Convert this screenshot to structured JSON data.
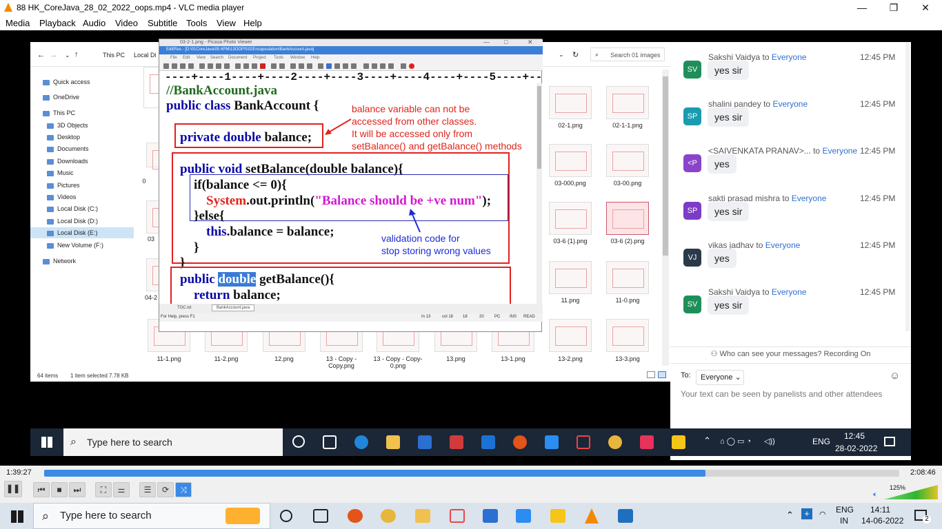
{
  "app": {
    "title": "88 HK_CoreJava_28_02_2022_oops.mp4 - VLC media player",
    "menu": [
      "Media",
      "Playback",
      "Audio",
      "Video",
      "Subtitle",
      "Tools",
      "View",
      "Help"
    ],
    "window_buttons": [
      "—",
      "❐",
      "✕"
    ]
  },
  "explorer": {
    "breadcrumb": [
      "This PC",
      "Local Di"
    ],
    "search_placeholder": "Search 01 images",
    "sidebar": [
      "Quick access",
      "OneDrive",
      "This PC",
      "3D Objects",
      "Desktop",
      "Documents",
      "Downloads",
      "Music",
      "Pictures",
      "Videos",
      "Local Disk (C:)",
      "Local Disk (D:)",
      "Local Disk (E:)",
      "New Volume (F:)",
      "Network"
    ],
    "thumbnails_right": [
      "02-1.png",
      "02-1-1.png",
      "03-000.png",
      "03-00.png",
      "03-6 (1).png",
      "03-6 (2).png",
      "11.png",
      "11-0.png"
    ],
    "thumbnails_bottom": [
      "11-1.png",
      "11-2.png",
      "12.png",
      "13 - Copy - Copy.png",
      "13 - Copy - Copy-0.png",
      "13.png",
      "13-1.png",
      "13-2.png",
      "13-3.png"
    ],
    "left_partial": [
      "0",
      "03",
      "04-2"
    ],
    "status": {
      "count": "64 items",
      "selected": "1 item selected  7.78 KB"
    }
  },
  "editplus": {
    "picasa_title": "03-2-1.png - Picasa Photo Viewer",
    "title": "EditPlus - [D:\\01CoreJava\\05 6PM\\13OOPS\\02Encapsulation\\BankAccount.java]",
    "menu": [
      "File",
      "Edit",
      "View",
      "Search",
      "Document",
      "Project",
      "Tools",
      "Window",
      "Help"
    ],
    "ruler": "----+----1----+----2----+----3----+----4----+----5----+----6---",
    "code": {
      "comment": "//BankAccount.java",
      "line_class_kw": "public class ",
      "line_class_name": "BankAccount {",
      "line_field_kw": "private double ",
      "line_field_name": "balance;",
      "line_set_kw": "public void ",
      "line_set_rest": "setBalance(double balance){",
      "line_if": "if(balance <= 0){",
      "line_print_a": "System",
      "line_print_b": ".out.println(",
      "line_print_str": "\"Balance should be +ve num\"",
      "line_print_c": ");",
      "line_else": "}else{",
      "line_this_kw": "this",
      "line_this_rest": ".balance = balance;",
      "line_close1": "}",
      "line_close2": "}",
      "line_get_kw": "public ",
      "line_get_sel": "double",
      "line_get_rest": " getBalance(){",
      "line_return_kw": "return ",
      "line_return_rest": "balance;"
    },
    "annotation1": [
      "balance variable can not be",
      "accessed from other classes.",
      "It will be accessed only from",
      "setBalance() and getBalance() methods"
    ],
    "annotation2": [
      "validation code for",
      "stop storing wrong values"
    ],
    "tabs": [
      "TOC.txt",
      "BankAccount.java"
    ],
    "status": {
      "help": "For Help, press F1",
      "ln": "In 13",
      "col": "col 18",
      "a": "18",
      "b": "20",
      "pc": "PC",
      "ins": "INS",
      "read": "READ"
    }
  },
  "chat": {
    "to_word": "to",
    "messages": [
      {
        "sender": "Sakshi Vaidya",
        "to": "Everyone",
        "time": "12:45 PM",
        "text": "yes sir",
        "initials": "SV",
        "color": "#1f8f5a"
      },
      {
        "sender": "shalini pandey",
        "to": "Everyone",
        "time": "12:45 PM",
        "text": "yes sir",
        "initials": "SP",
        "color": "#1a9bb0"
      },
      {
        "sender": "<SAIVENKATA PRANAV>...",
        "to": "Everyone",
        "time": "12:45 PM",
        "text": "yes",
        "initials": "<P",
        "color": "#8b44c9"
      },
      {
        "sender": "sakti prasad mishra",
        "to": "Everyone",
        "time": "12:45 PM",
        "text": "yes sir",
        "initials": "SP",
        "color": "#7c3cc6"
      },
      {
        "sender": "vikas jadhav",
        "to": "Everyone",
        "time": "12:45 PM",
        "text": "yes",
        "initials": "VJ",
        "color": "#2b3a4a"
      },
      {
        "sender": "Sakshi Vaidya",
        "to": "Everyone",
        "time": "12:45 PM",
        "text": "yes sir",
        "initials": "SV",
        "color": "#1f8f5a"
      }
    ],
    "who_can_see": "Who can see your messages? Recording On",
    "to_label": "To:",
    "to_value": "Everyone",
    "input_placeholder": "Your text can be seen by panelists and other attendees"
  },
  "inner_taskbar": {
    "search": "Type here to search",
    "time": "12:45",
    "date": "28-02-2022",
    "lang": "ENG"
  },
  "player": {
    "elapsed": "1:39:27",
    "total": "2:08:46",
    "progress_fraction": 0.773,
    "volume": "125%"
  },
  "host_taskbar": {
    "search": "Type here to search",
    "lang1": "ENG",
    "lang2": "IN",
    "time": "14:11",
    "date": "14-06-2022",
    "notif": "2"
  }
}
